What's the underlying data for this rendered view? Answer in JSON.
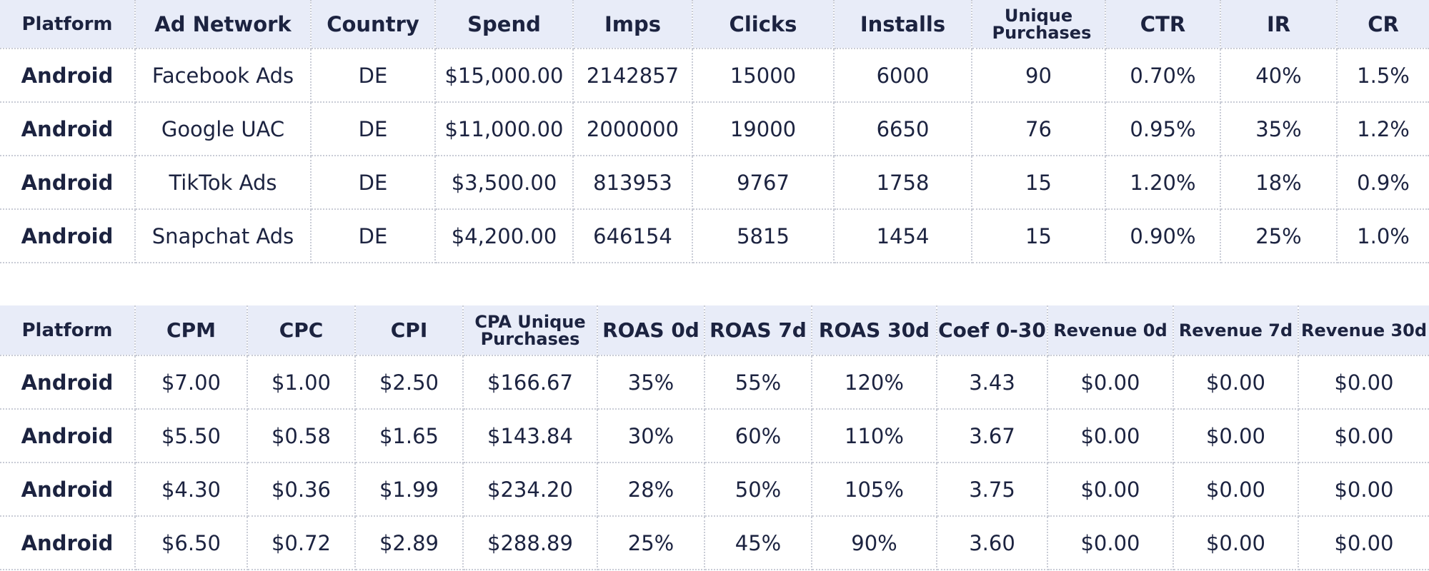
{
  "table1": {
    "headers": [
      "Platform",
      "Ad Network",
      "Country",
      "Spend",
      "Imps",
      "Clicks",
      "Installs",
      "Unique Purchases",
      "CTR",
      "IR",
      "CR"
    ],
    "rows": [
      [
        "Android",
        "Facebook Ads",
        "DE",
        "$15,000.00",
        "2142857",
        "15000",
        "6000",
        "90",
        "0.70%",
        "40%",
        "1.5%"
      ],
      [
        "Android",
        "Google UAC",
        "DE",
        "$11,000.00",
        "2000000",
        "19000",
        "6650",
        "76",
        "0.95%",
        "35%",
        "1.2%"
      ],
      [
        "Android",
        "TikTok Ads",
        "DE",
        "$3,500.00",
        "813953",
        "9767",
        "1758",
        "15",
        "1.20%",
        "18%",
        "0.9%"
      ],
      [
        "Android",
        "Snapchat Ads",
        "DE",
        "$4,200.00",
        "646154",
        "5815",
        "1454",
        "15",
        "0.90%",
        "25%",
        "1.0%"
      ]
    ]
  },
  "table2": {
    "headers": [
      "Platform",
      "CPM",
      "CPC",
      "CPI",
      "CPA Unique Purchases",
      "ROAS 0d",
      "ROAS 7d",
      "ROAS 30d",
      "Coef 0-30",
      "Revenue 0d",
      "Revenue 7d",
      "Revenue 30d"
    ],
    "rows": [
      [
        "Android",
        "$7.00",
        "$1.00",
        "$2.50",
        "$166.67",
        "35%",
        "55%",
        "120%",
        "3.43",
        "$0.00",
        "$0.00",
        "$0.00"
      ],
      [
        "Android",
        "$5.50",
        "$0.58",
        "$1.65",
        "$143.84",
        "30%",
        "60%",
        "110%",
        "3.67",
        "$0.00",
        "$0.00",
        "$0.00"
      ],
      [
        "Android",
        "$4.30",
        "$0.36",
        "$1.99",
        "$234.20",
        "28%",
        "50%",
        "105%",
        "3.75",
        "$0.00",
        "$0.00",
        "$0.00"
      ],
      [
        "Android",
        "$6.50",
        "$0.72",
        "$2.89",
        "$288.89",
        "25%",
        "45%",
        "90%",
        "3.60",
        "$0.00",
        "$0.00",
        "$0.00"
      ]
    ]
  }
}
